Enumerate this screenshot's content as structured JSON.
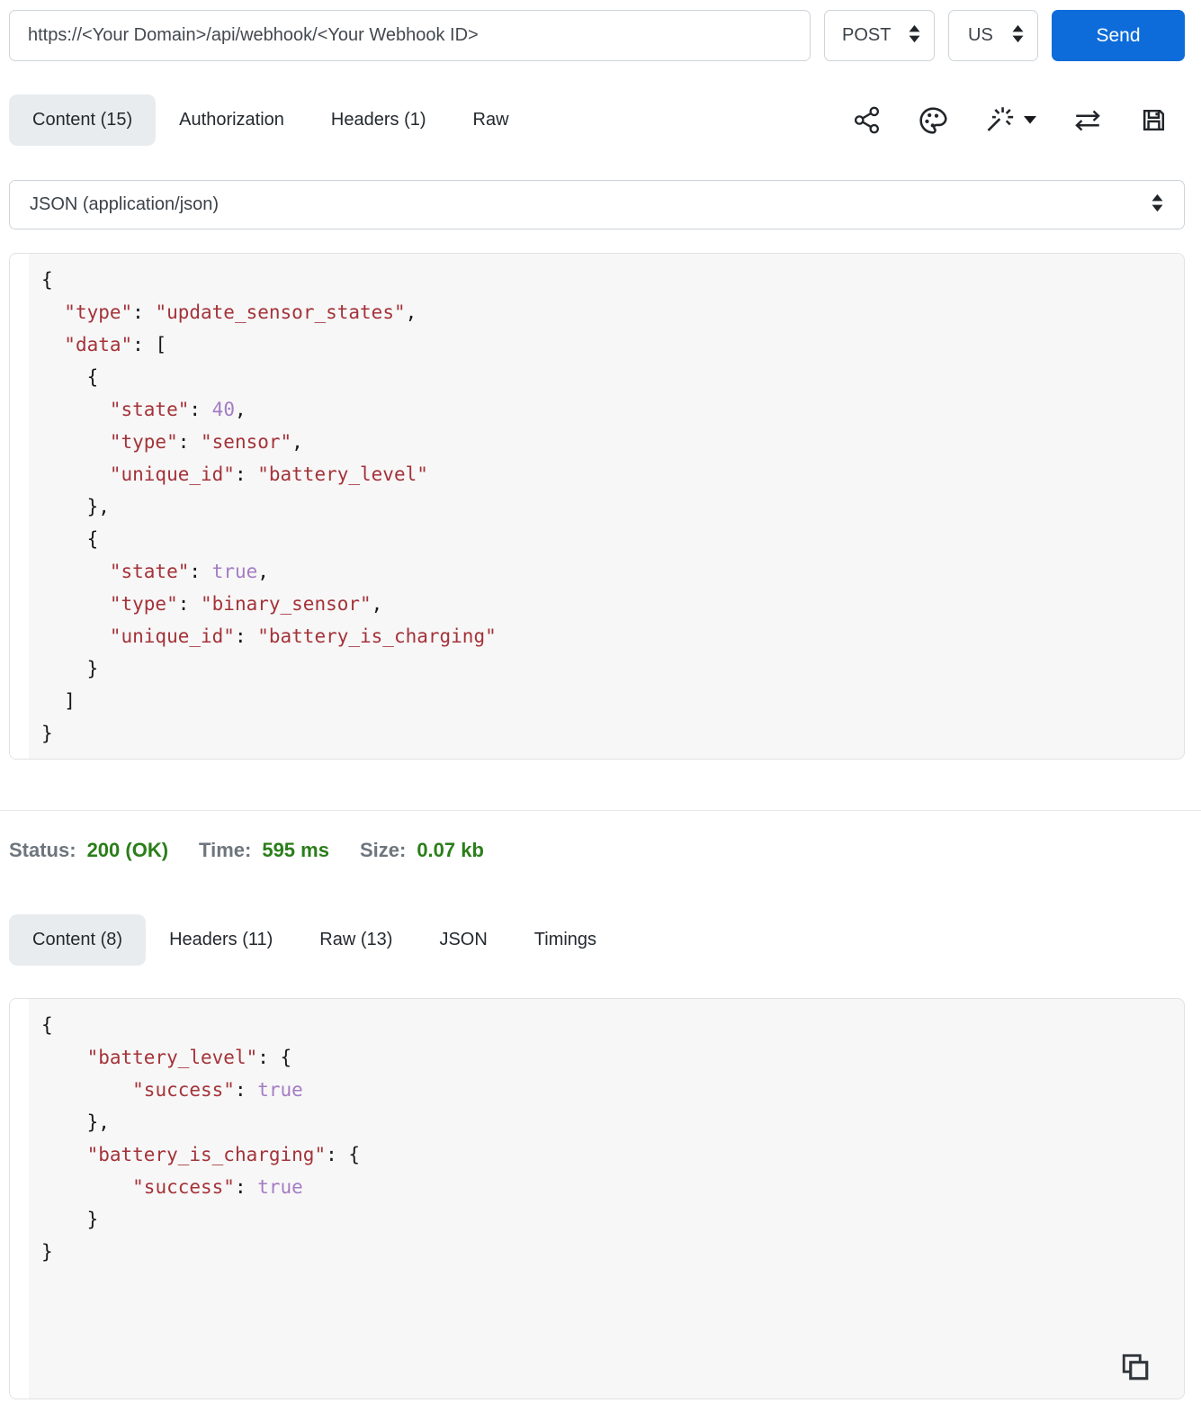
{
  "request_bar": {
    "url": "https://<Your Domain>/api/webhook/<Your Webhook ID>",
    "method": "POST",
    "region": "US",
    "send_label": "Send"
  },
  "request_tabs": [
    {
      "label": "Content (15)",
      "active": true
    },
    {
      "label": "Authorization",
      "active": false
    },
    {
      "label": "Headers (1)",
      "active": false
    },
    {
      "label": "Raw",
      "active": false
    }
  ],
  "toolbar_icons": [
    "share-icon",
    "palette-icon",
    "magic-wand-menu-icon",
    "swap-arrows-icon",
    "save-icon"
  ],
  "body_type": {
    "value": "JSON (application/json)"
  },
  "request_body_lines": [
    [
      [
        "p",
        "{"
      ]
    ],
    [
      [
        "p",
        "  "
      ],
      [
        "s",
        "\"type\""
      ],
      [
        "p",
        ": "
      ],
      [
        "s",
        "\"update_sensor_states\""
      ],
      [
        "p",
        ","
      ]
    ],
    [
      [
        "p",
        "  "
      ],
      [
        "s",
        "\"data\""
      ],
      [
        "p",
        ": ["
      ]
    ],
    [
      [
        "p",
        "    {"
      ]
    ],
    [
      [
        "p",
        "      "
      ],
      [
        "s",
        "\"state\""
      ],
      [
        "p",
        ": "
      ],
      [
        "l",
        "40"
      ],
      [
        "p",
        ","
      ]
    ],
    [
      [
        "p",
        "      "
      ],
      [
        "s",
        "\"type\""
      ],
      [
        "p",
        ": "
      ],
      [
        "s",
        "\"sensor\""
      ],
      [
        "p",
        ","
      ]
    ],
    [
      [
        "p",
        "      "
      ],
      [
        "s",
        "\"unique_id\""
      ],
      [
        "p",
        ": "
      ],
      [
        "s",
        "\"battery_level\""
      ]
    ],
    [
      [
        "p",
        "    },"
      ]
    ],
    [
      [
        "p",
        "    {"
      ]
    ],
    [
      [
        "p",
        "      "
      ],
      [
        "s",
        "\"state\""
      ],
      [
        "p",
        ": "
      ],
      [
        "l",
        "true"
      ],
      [
        "p",
        ","
      ]
    ],
    [
      [
        "p",
        "      "
      ],
      [
        "s",
        "\"type\""
      ],
      [
        "p",
        ": "
      ],
      [
        "s",
        "\"binary_sensor\""
      ],
      [
        "p",
        ","
      ]
    ],
    [
      [
        "p",
        "      "
      ],
      [
        "s",
        "\"unique_id\""
      ],
      [
        "p",
        ": "
      ],
      [
        "s",
        "\"battery_is_charging\""
      ]
    ],
    [
      [
        "p",
        "    }"
      ]
    ],
    [
      [
        "p",
        "  ]"
      ]
    ],
    [
      [
        "p",
        "}"
      ]
    ]
  ],
  "status_bar": {
    "status_label": "Status:",
    "status_value": "200 (OK)",
    "time_label": "Time:",
    "time_value": "595 ms",
    "size_label": "Size:",
    "size_value": "0.07 kb"
  },
  "response_tabs": [
    {
      "label": "Content (8)",
      "active": true
    },
    {
      "label": "Headers (11)",
      "active": false
    },
    {
      "label": "Raw (13)",
      "active": false
    },
    {
      "label": "JSON",
      "active": false
    },
    {
      "label": "Timings",
      "active": false
    }
  ],
  "response_body_lines": [
    [
      [
        "p",
        "{"
      ]
    ],
    [
      [
        "p",
        "    "
      ],
      [
        "s",
        "\"battery_level\""
      ],
      [
        "p",
        ": {"
      ]
    ],
    [
      [
        "p",
        "        "
      ],
      [
        "s",
        "\"success\""
      ],
      [
        "p",
        ": "
      ],
      [
        "l",
        "true"
      ]
    ],
    [
      [
        "p",
        "    },"
      ]
    ],
    [
      [
        "p",
        "    "
      ],
      [
        "s",
        "\"battery_is_charging\""
      ],
      [
        "p",
        ": {"
      ]
    ],
    [
      [
        "p",
        "        "
      ],
      [
        "s",
        "\"success\""
      ],
      [
        "p",
        ": "
      ],
      [
        "l",
        "true"
      ]
    ],
    [
      [
        "p",
        "    }"
      ]
    ],
    [
      [
        "p",
        "}"
      ]
    ]
  ],
  "icons": {
    "copy": "copy-icon",
    "select_arrows": "select-arrows-icon",
    "menu_caret": "caret-down-icon"
  },
  "colors": {
    "accent_blue": "#0d6cd9",
    "success_green": "#2b7e1a",
    "muted_gray": "#6d757d",
    "json_string": "#a43339",
    "json_literal": "#a47cc4",
    "json_punct": "#16181b"
  }
}
